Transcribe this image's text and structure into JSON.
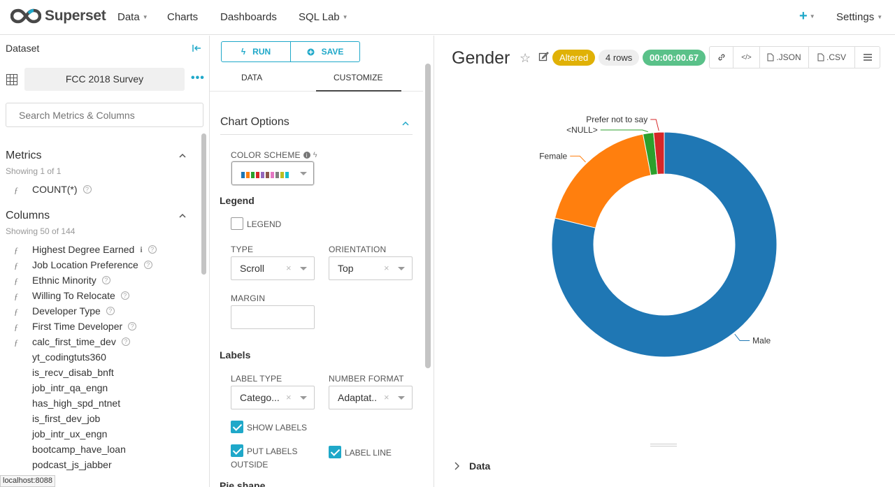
{
  "app": {
    "logo_text": "Superset",
    "nav": [
      {
        "label": "Data",
        "has_caret": true
      },
      {
        "label": "Charts",
        "has_caret": false
      },
      {
        "label": "Dashboards",
        "has_caret": false
      },
      {
        "label": "SQL Lab",
        "has_caret": true
      }
    ],
    "plus_label": "+",
    "settings_label": "Settings",
    "accent_color": "#1fa8c9"
  },
  "dataset_panel": {
    "title": "Dataset",
    "dataset_name": "FCC 2018 Survey",
    "search_placeholder": "Search Metrics & Columns",
    "metrics": {
      "title": "Metrics",
      "showing": "Showing 1 of 1",
      "items": [
        "COUNT(*)"
      ]
    },
    "columns": {
      "title": "Columns",
      "showing": "Showing 50 of 144",
      "items": [
        {
          "name": "Highest Degree Earned",
          "fx": true,
          "info": true,
          "help": true
        },
        {
          "name": "Job Location Preference",
          "fx": true,
          "info": false,
          "help": true
        },
        {
          "name": "Ethnic Minority",
          "fx": true,
          "info": false,
          "help": true
        },
        {
          "name": "Willing To Relocate",
          "fx": true,
          "info": false,
          "help": true
        },
        {
          "name": "Developer Type",
          "fx": true,
          "info": false,
          "help": true
        },
        {
          "name": "First Time Developer",
          "fx": true,
          "info": false,
          "help": true
        },
        {
          "name": "calc_first_time_dev",
          "fx": true,
          "info": false,
          "help": true
        },
        {
          "name": "yt_codingtuts360",
          "fx": false,
          "info": false,
          "help": false
        },
        {
          "name": "is_recv_disab_bnft",
          "fx": false,
          "info": false,
          "help": false
        },
        {
          "name": "job_intr_qa_engn",
          "fx": false,
          "info": false,
          "help": false
        },
        {
          "name": "has_high_spd_ntnet",
          "fx": false,
          "info": false,
          "help": false
        },
        {
          "name": "is_first_dev_job",
          "fx": false,
          "info": false,
          "help": false
        },
        {
          "name": "job_intr_ux_engn",
          "fx": false,
          "info": false,
          "help": false
        },
        {
          "name": "bootcamp_have_loan",
          "fx": false,
          "info": false,
          "help": false
        },
        {
          "name": "podcast_js_jabber",
          "fx": false,
          "info": false,
          "help": false
        }
      ]
    },
    "status_url": "localhost:8088"
  },
  "control_panel": {
    "run_label": "RUN",
    "save_label": "SAVE",
    "tabs": [
      {
        "label": "DATA",
        "active": false
      },
      {
        "label": "CUSTOMIZE",
        "active": true
      }
    ],
    "section_title": "Chart Options",
    "color_scheme_label": "COLOR SCHEME",
    "color_swatches": [
      "#1f77b4",
      "#ff7f0e",
      "#2ca02c",
      "#d62728",
      "#9467bd",
      "#8c564b",
      "#e377c2",
      "#7f7f7f",
      "#bcbd22",
      "#17becf"
    ],
    "legend_heading": "Legend",
    "legend_checkbox": {
      "label": "LEGEND",
      "checked": false
    },
    "type": {
      "label": "TYPE",
      "value": "Scroll"
    },
    "orientation": {
      "label": "ORIENTATION",
      "value": "Top"
    },
    "margin": {
      "label": "MARGIN",
      "value": ""
    },
    "labels_heading": "Labels",
    "label_type": {
      "label": "LABEL TYPE",
      "value": "Catego..."
    },
    "number_format": {
      "label": "NUMBER FORMAT",
      "value": "Adaptat.."
    },
    "show_labels": {
      "label": "SHOW LABELS",
      "checked": true
    },
    "put_labels_outside": {
      "label_line1": "PUT LABELS",
      "label_line2": "OUTSIDE",
      "checked": true
    },
    "label_line": {
      "label": "LABEL LINE",
      "checked": true
    },
    "pie_shape_heading": "Pie shape"
  },
  "chart_header": {
    "title": "Gender",
    "altered_badge": "Altered",
    "rows_badge": "4 rows",
    "timer": "00:00:00.67",
    "json_label": ".JSON",
    "csv_label": ".CSV",
    "data_toggle_label": "Data"
  },
  "chart_data": {
    "type": "pie",
    "donut": true,
    "categories": [
      "Male",
      "Female",
      "<NULL>",
      "Prefer not to say"
    ],
    "values": [
      78,
      18,
      1.5,
      1.5
    ],
    "colors": [
      "#1f77b4",
      "#ff7f0e",
      "#2ca02c",
      "#d62728"
    ],
    "title": "",
    "legend": false
  }
}
